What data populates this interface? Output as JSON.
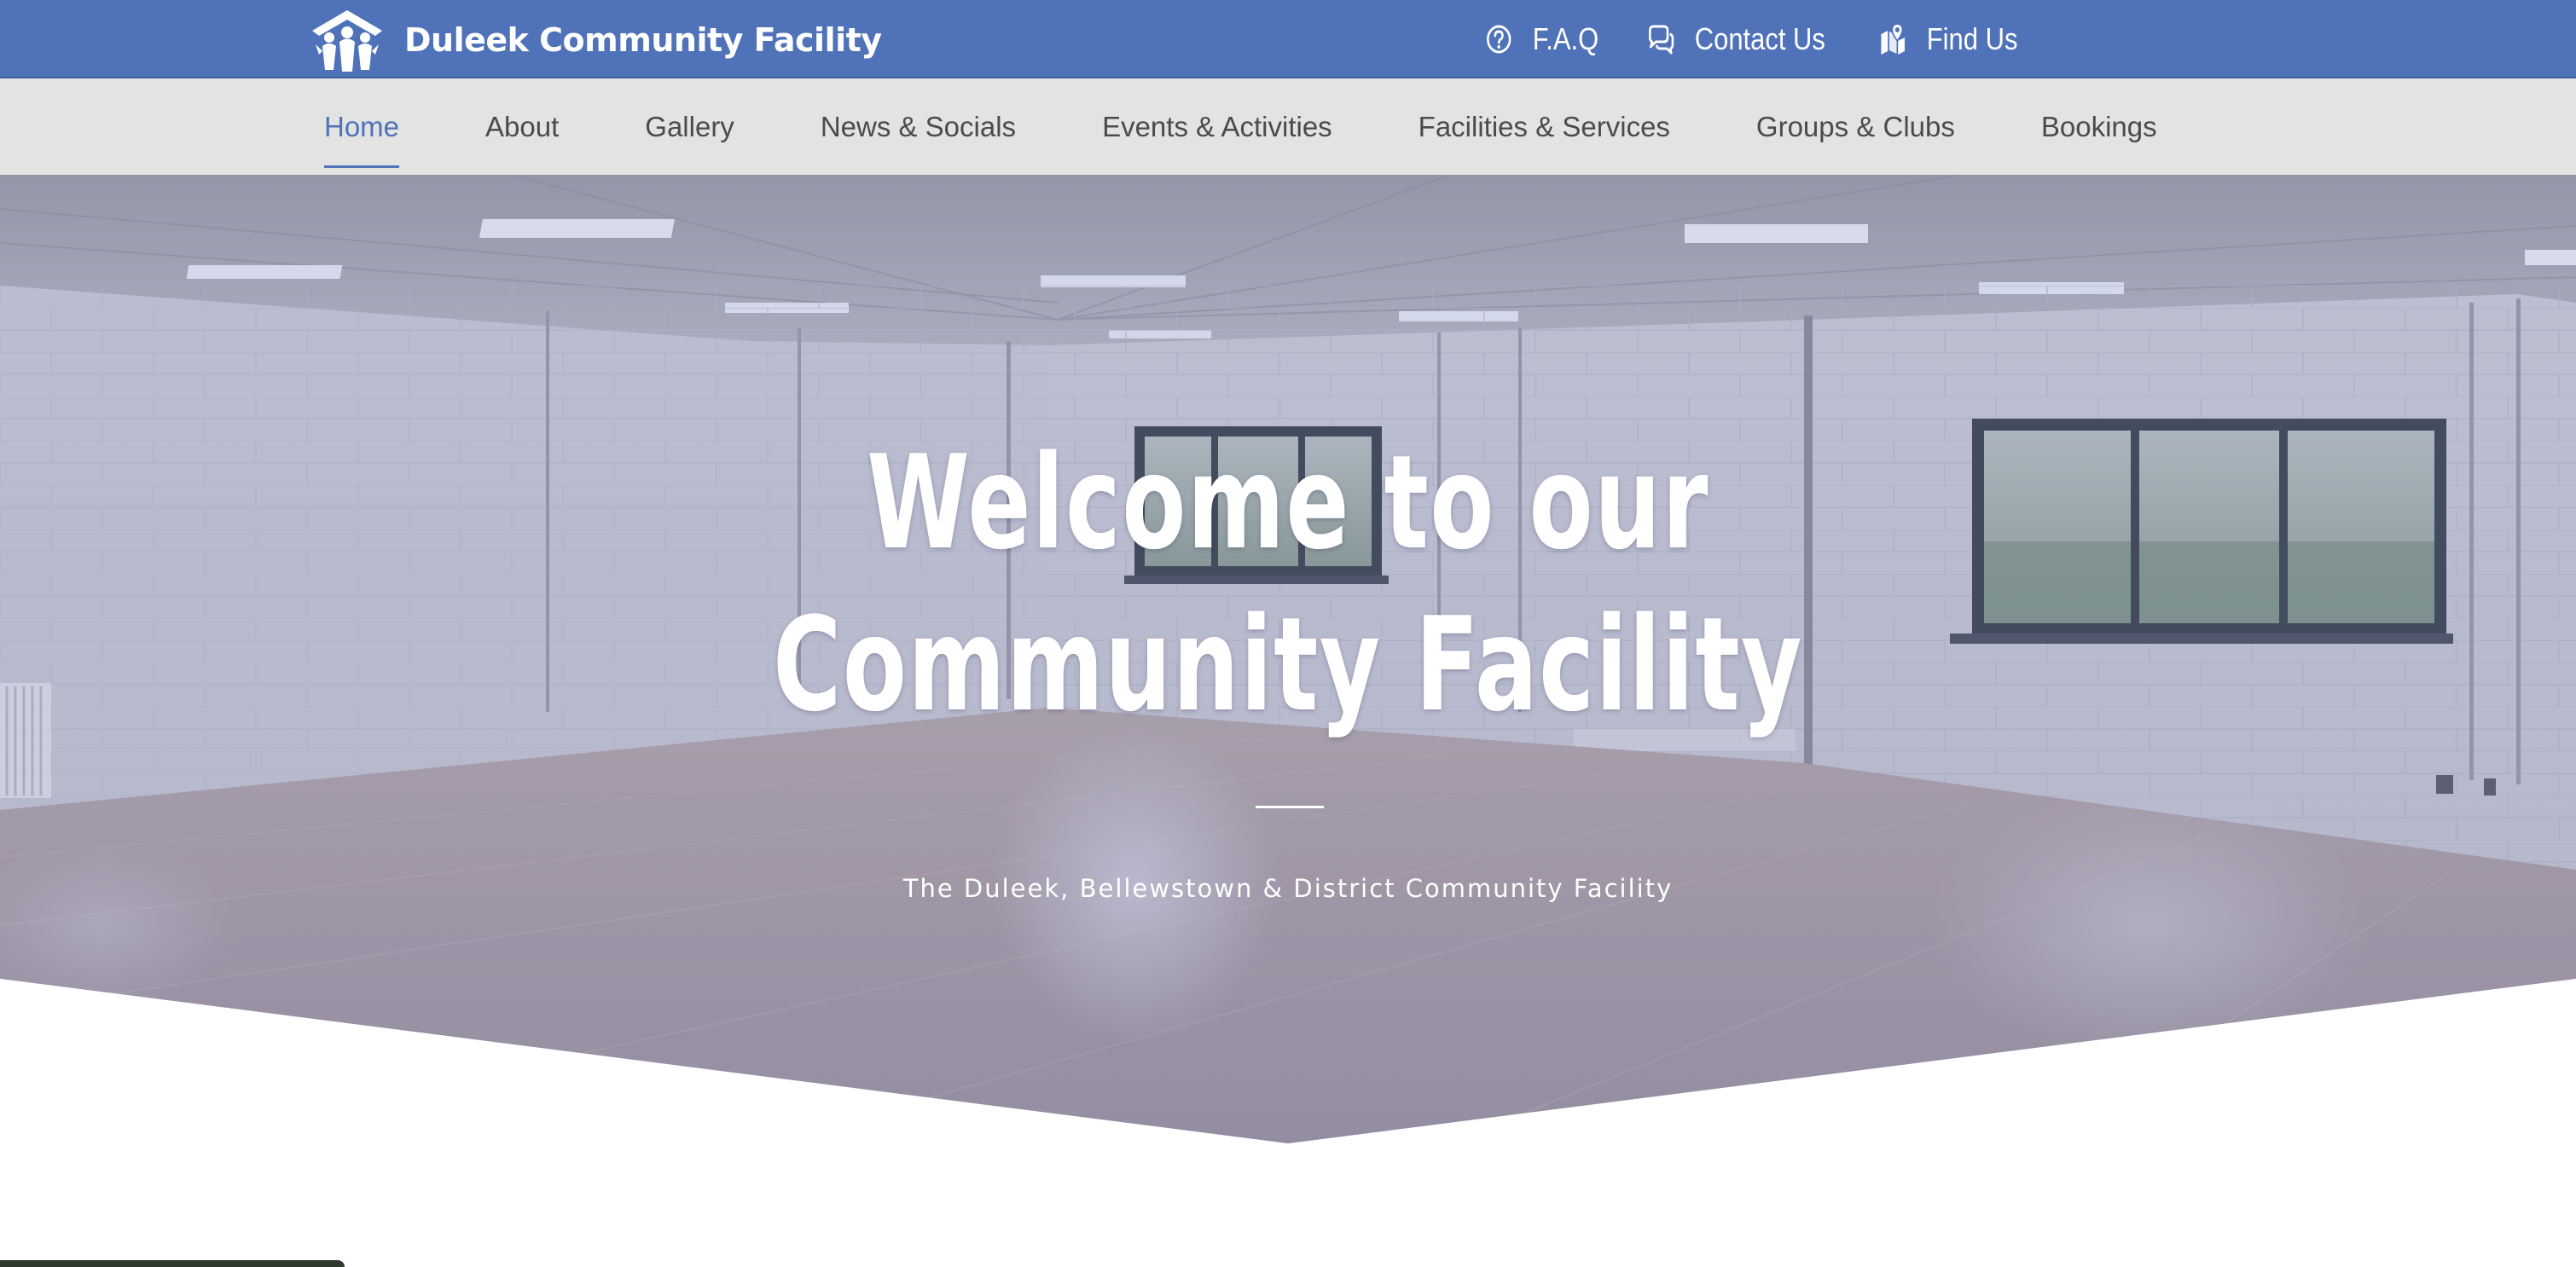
{
  "site": {
    "name": "Duleek Community Facility"
  },
  "topbar": {
    "background": "#4f72b8",
    "links": [
      {
        "label": "F.A.Q",
        "icon": "question-circle-icon"
      },
      {
        "label": "Contact Us",
        "icon": "chat-bubbles-icon"
      },
      {
        "label": "Find Us",
        "icon": "map-pin-icon"
      }
    ]
  },
  "nav": {
    "background": "#e3e3e3",
    "active_color": "#4f72b8",
    "items": [
      {
        "label": "Home",
        "active": true
      },
      {
        "label": "About"
      },
      {
        "label": "Gallery"
      },
      {
        "label": "News & Socials"
      },
      {
        "label": "Events & Activities"
      },
      {
        "label": "Facilities & Services"
      },
      {
        "label": "Groups & Clubs"
      },
      {
        "label": "Bookings"
      }
    ]
  },
  "hero": {
    "title_line1": "Welcome to our",
    "title_line2": "Community Facility",
    "subtitle": "The Duleek, Bellewstown & District Community Facility"
  }
}
